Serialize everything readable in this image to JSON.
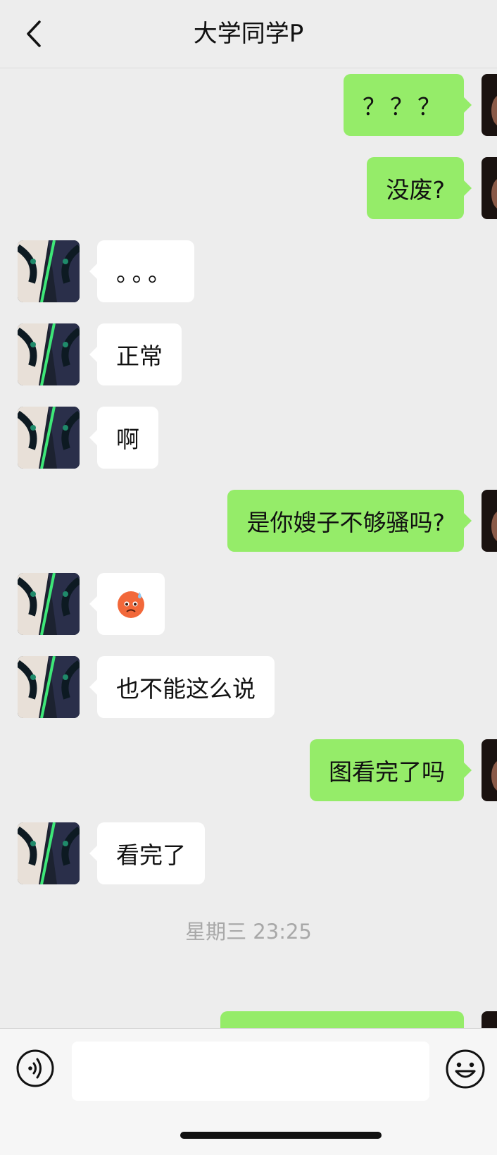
{
  "header": {
    "back_icon": "chevron-left-icon",
    "title": "大学同学P"
  },
  "messages": [
    {
      "side": "right",
      "type": "text",
      "text": "？？？"
    },
    {
      "side": "right",
      "type": "text",
      "text": "没废?"
    },
    {
      "side": "left",
      "type": "text",
      "text": "。。。"
    },
    {
      "side": "left",
      "type": "text",
      "text": "正常"
    },
    {
      "side": "left",
      "type": "text",
      "text": "啊"
    },
    {
      "side": "right",
      "type": "text",
      "text": "是你嫂子不够骚吗?"
    },
    {
      "side": "left",
      "type": "emoji",
      "icon": "cold-sweat-face-emoji"
    },
    {
      "side": "left",
      "type": "text",
      "text": "也不能这么说"
    },
    {
      "side": "right",
      "type": "text",
      "text": "图看完了吗"
    },
    {
      "side": "left",
      "type": "text",
      "text": "看完了"
    }
  ],
  "timestamp": "星期三 23:25",
  "input_bar": {
    "voice_icon": "voice-icon",
    "input_value": "",
    "emoji_icon": "emoji-smile-icon"
  },
  "colors": {
    "background": "#ededed",
    "sent_bubble": "#95ec69",
    "received_bubble": "#ffffff",
    "timestamp_text": "#a8a8a8"
  }
}
